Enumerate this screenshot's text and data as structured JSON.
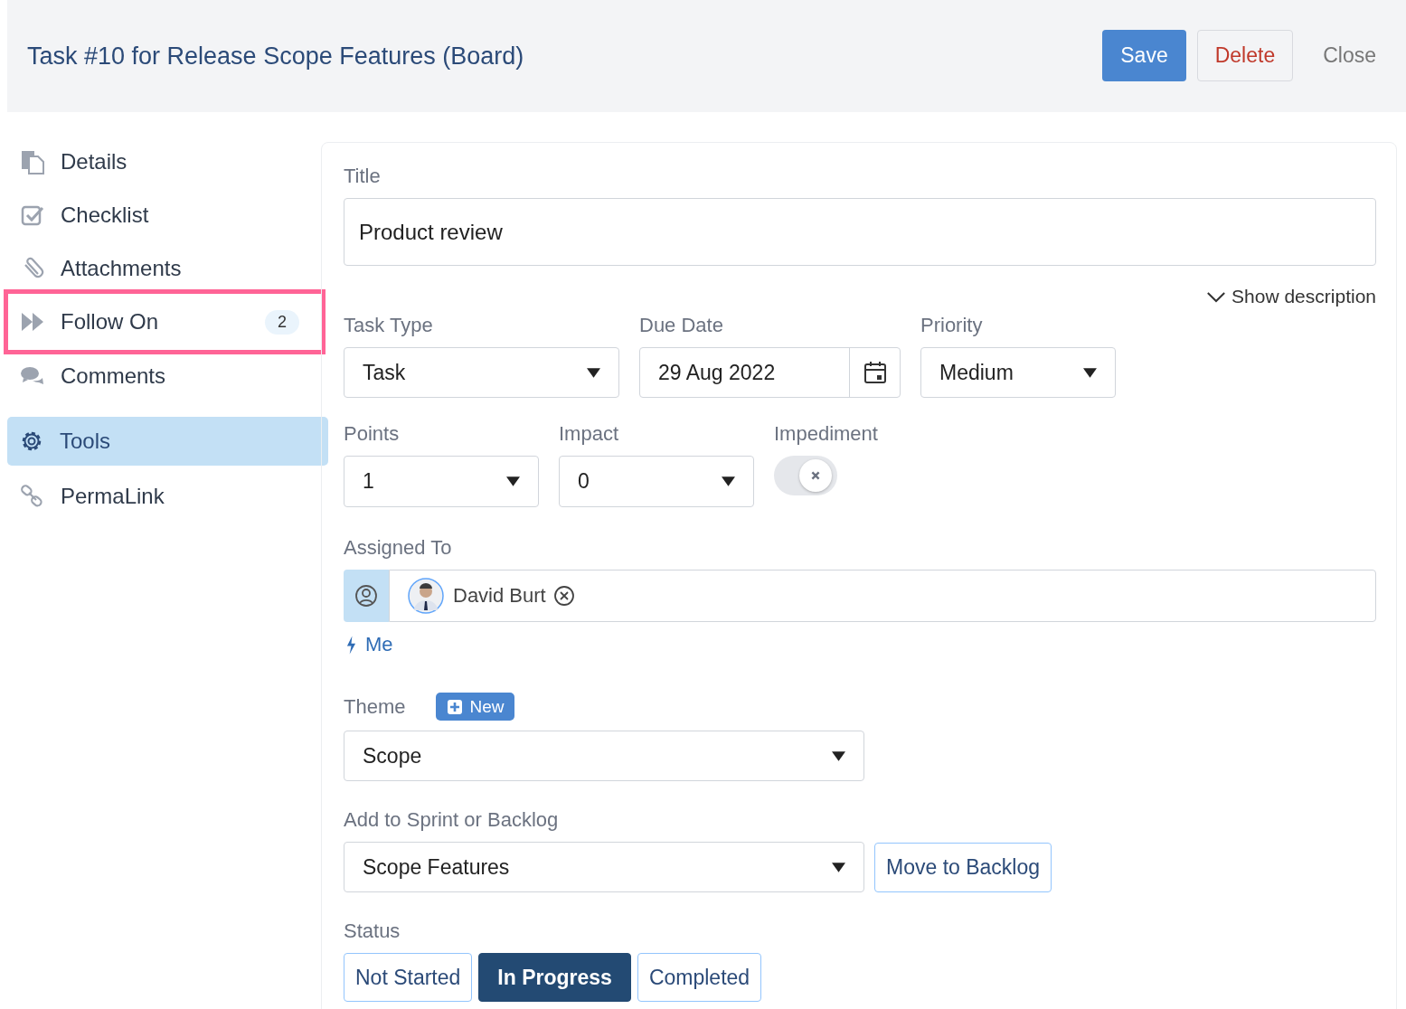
{
  "header": {
    "title": "Task #10 for Release Scope Features (Board)",
    "buttons": [
      {
        "label": "Save",
        "kind": "primary"
      },
      {
        "label": "Delete",
        "kind": "danger"
      },
      {
        "label": "Close",
        "kind": "plain"
      }
    ]
  },
  "sidebar": {
    "items": [
      {
        "label": "Details",
        "kind": "document",
        "selected": false,
        "highlighted": false
      },
      {
        "label": "Checklist",
        "kind": "checkbox",
        "selected": false,
        "highlighted": false
      },
      {
        "label": "Attachments",
        "kind": "paperclip",
        "selected": false,
        "highlighted": false
      },
      {
        "label": "Follow On",
        "kind": "forward",
        "badge": "2",
        "selected": false,
        "highlighted": true
      },
      {
        "label": "Comments",
        "kind": "chat",
        "selected": false,
        "highlighted": false
      },
      {
        "label": "Tools",
        "kind": "gear",
        "selected": true,
        "highlighted": false
      },
      {
        "label": "PermaLink",
        "kind": "link",
        "selected": false,
        "highlighted": false
      }
    ]
  },
  "form": {
    "title": {
      "label": "Title",
      "value": "Product review"
    },
    "show_description": "Show description",
    "task_type": {
      "label": "Task Type",
      "value": "Task"
    },
    "due_date": {
      "label": "Due Date",
      "value": "29 Aug 2022"
    },
    "priority": {
      "label": "Priority",
      "value": "Medium"
    },
    "points": {
      "label": "Points",
      "value": "1"
    },
    "impact": {
      "label": "Impact",
      "value": "0"
    },
    "impediment": {
      "label": "Impediment",
      "on": false
    },
    "assigned_to": {
      "label": "Assigned To",
      "assignees": [
        {
          "name": "David Burt"
        }
      ]
    },
    "me_link": "Me",
    "theme": {
      "label": "Theme",
      "new_button": "New",
      "value": "Scope"
    },
    "sprint": {
      "label": "Add to Sprint or Backlog",
      "value": "Scope Features",
      "button": "Move to Backlog"
    },
    "status": {
      "label": "Status",
      "options": [
        {
          "label": "Not Started",
          "selected": false
        },
        {
          "label": "In Progress",
          "selected": true
        },
        {
          "label": "Completed",
          "selected": false
        }
      ]
    }
  }
}
